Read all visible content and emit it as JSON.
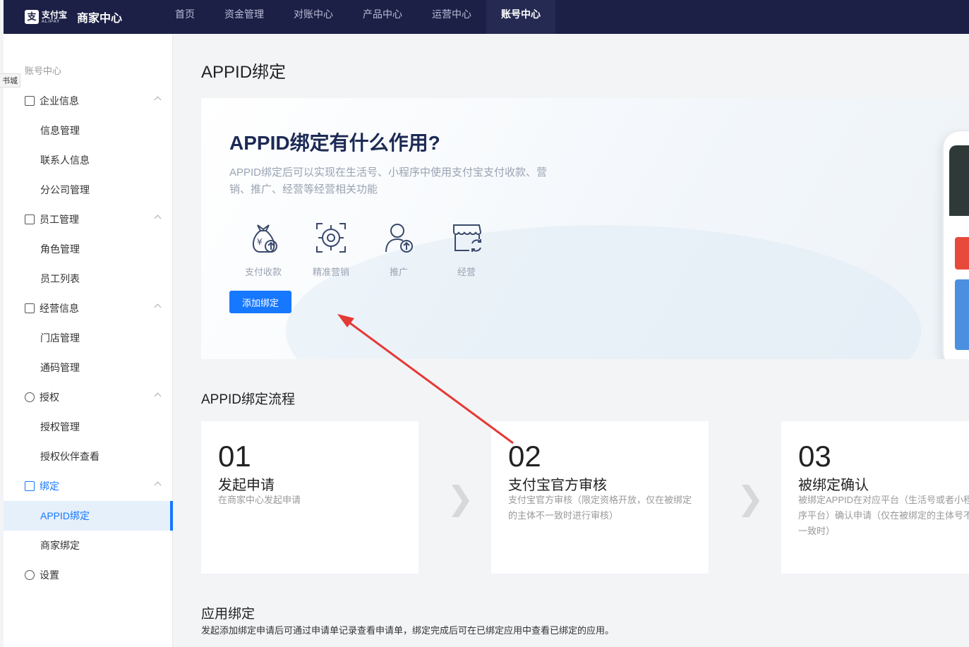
{
  "topbar": {
    "logo_cn": "支付宝",
    "logo_en": "ALIPAY",
    "title": "商家中心",
    "nav": [
      {
        "label": "首页"
      },
      {
        "label": "资金管理"
      },
      {
        "label": "对账中心"
      },
      {
        "label": "产品中心"
      },
      {
        "label": "运营中心"
      },
      {
        "label": "账号中心",
        "active": true
      }
    ]
  },
  "sidebar": {
    "heading": "账号中心",
    "floating_tag": "书城",
    "items": [
      {
        "label": "企业信息",
        "type": "group",
        "icon": "id-card-icon"
      },
      {
        "label": "信息管理",
        "type": "sub"
      },
      {
        "label": "联系人信息",
        "type": "sub"
      },
      {
        "label": "分公司管理",
        "type": "sub"
      },
      {
        "label": "员工管理",
        "type": "group",
        "icon": "staff-icon"
      },
      {
        "label": "角色管理",
        "type": "sub"
      },
      {
        "label": "员工列表",
        "type": "sub"
      },
      {
        "label": "经营信息",
        "type": "group",
        "icon": "business-info-icon"
      },
      {
        "label": "门店管理",
        "type": "sub"
      },
      {
        "label": "通码管理",
        "type": "sub"
      },
      {
        "label": "授权",
        "type": "group",
        "icon": "shield-check-icon"
      },
      {
        "label": "授权管理",
        "type": "sub"
      },
      {
        "label": "授权伙伴查看",
        "type": "sub"
      },
      {
        "label": "绑定",
        "type": "group",
        "icon": "bind-icon",
        "active": true
      },
      {
        "label": "APPID绑定",
        "type": "sub",
        "selected": true
      },
      {
        "label": "商家绑定",
        "type": "sub"
      },
      {
        "label": "设置",
        "type": "group",
        "icon": "gear-icon"
      }
    ]
  },
  "main": {
    "page_title": "APPID绑定",
    "hero": {
      "title": "APPID绑定有什么作用?",
      "desc": "APPID绑定后可以实现在生活号、小程序中使用支付宝支付收款、营销、推广、经营等经营相关功能",
      "features": [
        {
          "label": "支付收款",
          "icon": "money-bag-icon"
        },
        {
          "label": "精准营销",
          "icon": "target-icon"
        },
        {
          "label": "推广",
          "icon": "user-up-icon"
        },
        {
          "label": "经营",
          "icon": "store-icon"
        }
      ],
      "button": "添加绑定"
    },
    "flow": {
      "title": "APPID绑定流程",
      "steps": [
        {
          "num": "01",
          "name": "发起申请",
          "desc": "在商家中心发起申请"
        },
        {
          "num": "02",
          "name": "支付宝官方审核",
          "desc": "支付宝官方审核（限定资格开放，仅在被绑定的主体不一致时进行审核）"
        },
        {
          "num": "03",
          "name": "被绑定确认",
          "desc": "被绑定APPID在对应平台（生活号或者小程序平台）确认申请（仅在被绑定的主体号不一致时）"
        }
      ],
      "arrow": "❯"
    },
    "apply": {
      "title": "应用绑定",
      "desc": "发起添加绑定申请后可通过申请单记录查看申请单，绑定完成后可在已绑定应用中查看已绑定的应用。"
    }
  },
  "annotation": {
    "color": "#e53935"
  }
}
